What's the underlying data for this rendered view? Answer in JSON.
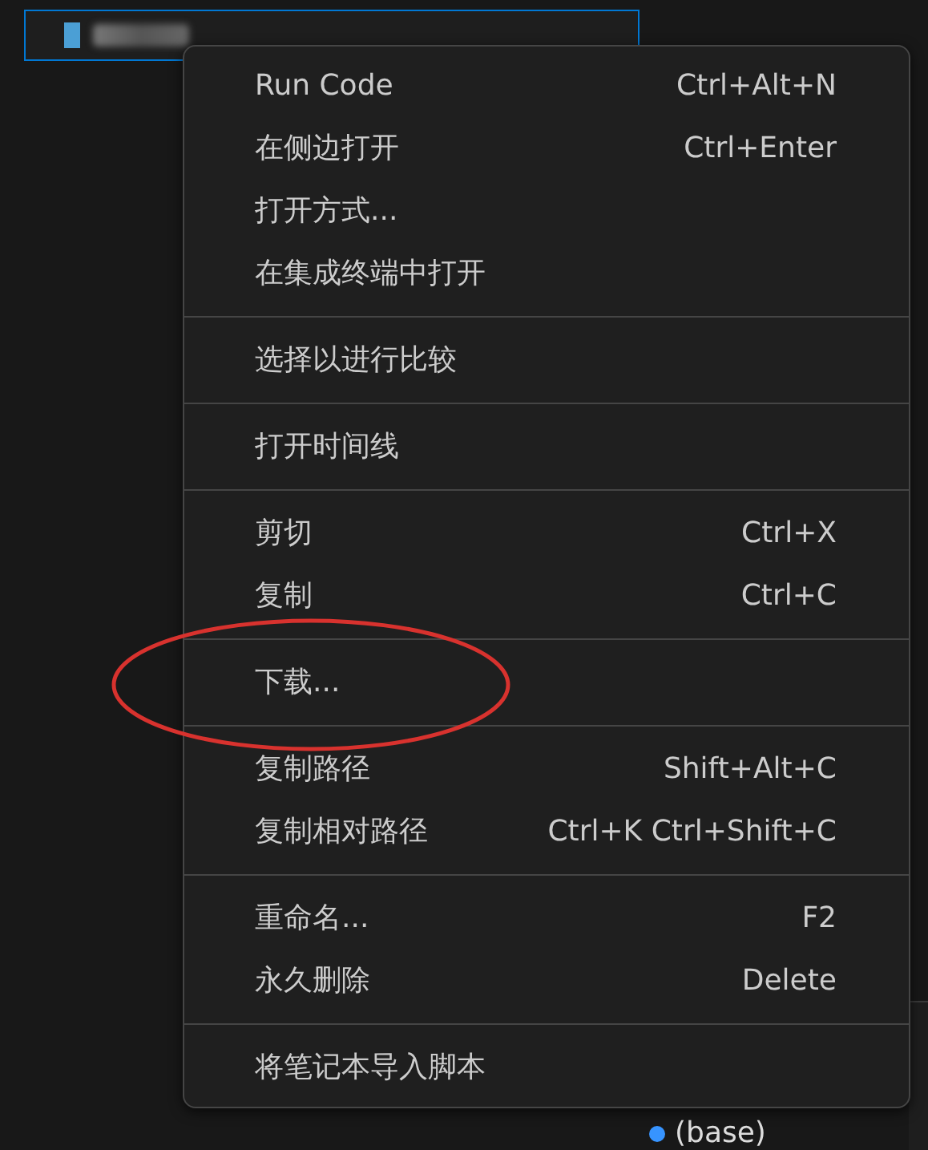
{
  "explorer": {
    "selected_file": {
      "selected": true
    }
  },
  "context_menu": {
    "groups": [
      {
        "items": [
          {
            "label": "Run Code",
            "shortcut": "Ctrl+Alt+N"
          },
          {
            "label": "在侧边打开",
            "shortcut": "Ctrl+Enter"
          },
          {
            "label": "打开方式..."
          },
          {
            "label": "在集成终端中打开"
          }
        ]
      },
      {
        "items": [
          {
            "label": "选择以进行比较"
          }
        ]
      },
      {
        "items": [
          {
            "label": "打开时间线"
          }
        ]
      },
      {
        "items": [
          {
            "label": "剪切",
            "shortcut": "Ctrl+X"
          },
          {
            "label": "复制",
            "shortcut": "Ctrl+C"
          }
        ]
      },
      {
        "items": [
          {
            "label": "下载..."
          }
        ]
      },
      {
        "items": [
          {
            "label": "复制路径",
            "shortcut": "Shift+Alt+C"
          },
          {
            "label": "复制相对路径",
            "shortcut": "Ctrl+K Ctrl+Shift+C"
          }
        ]
      },
      {
        "items": [
          {
            "label": "重命名...",
            "shortcut": "F2"
          },
          {
            "label": "永久删除",
            "shortcut": "Delete"
          }
        ]
      },
      {
        "items": [
          {
            "label": "将笔记本导入脚本"
          }
        ]
      }
    ]
  },
  "annotation": {
    "kind": "ellipse",
    "color": "#d8322e"
  },
  "terminal": {
    "prompt": "(base)"
  }
}
